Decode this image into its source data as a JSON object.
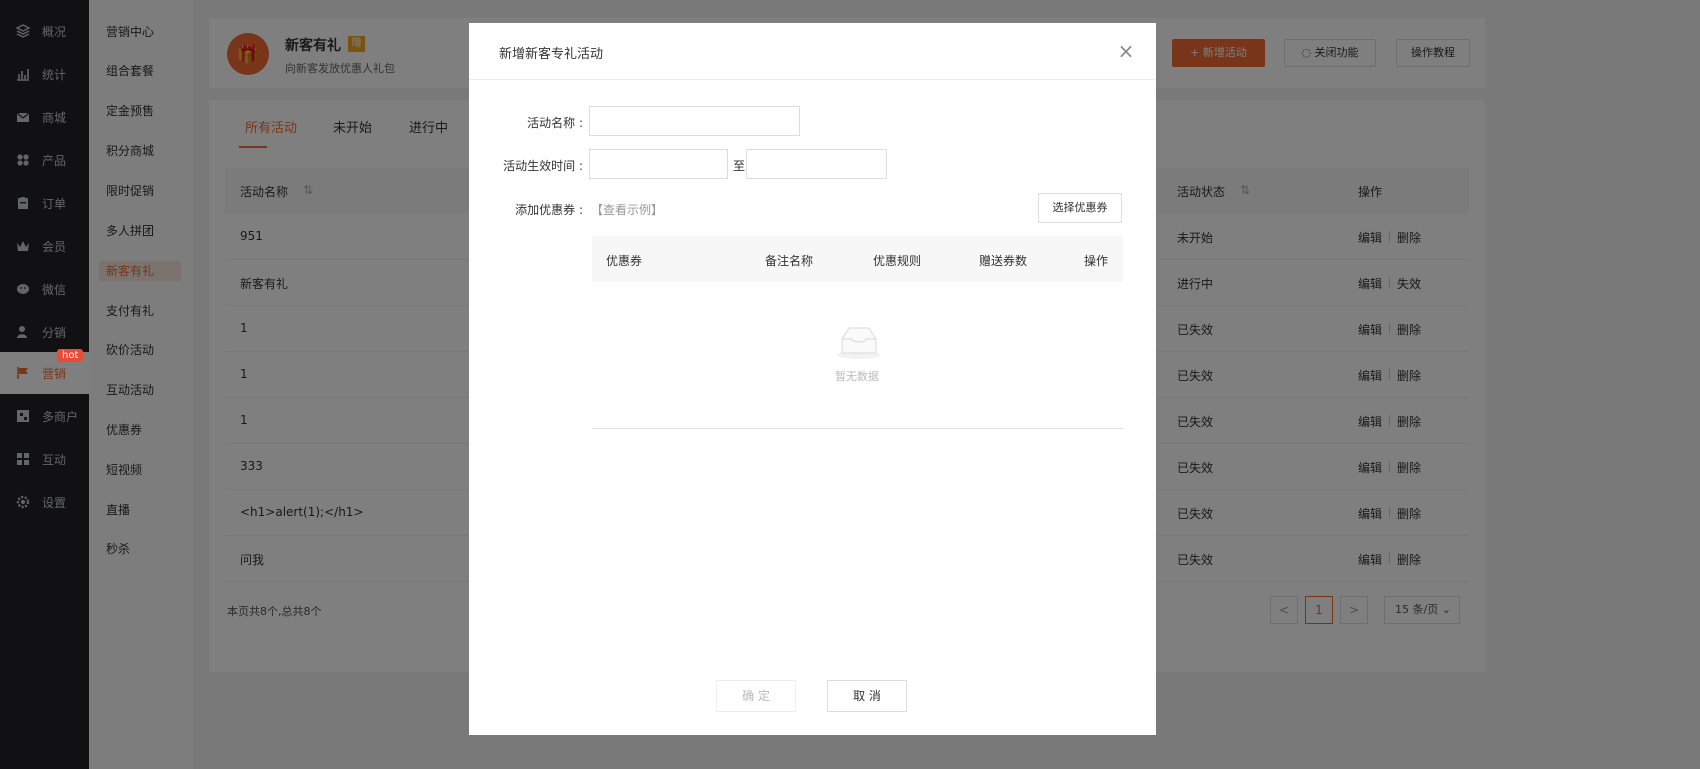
{
  "nav": {
    "items": [
      {
        "label": "概况",
        "icon": "layers-icon"
      },
      {
        "label": "统计",
        "icon": "chart-icon"
      },
      {
        "label": "商城",
        "icon": "mail-icon"
      },
      {
        "label": "产品",
        "icon": "grid-icon"
      },
      {
        "label": "订单",
        "icon": "clipboard-icon"
      },
      {
        "label": "会员",
        "icon": "crown-icon"
      },
      {
        "label": "微信",
        "icon": "wechat-icon"
      },
      {
        "label": "分销",
        "icon": "user-icon"
      },
      {
        "label": "营销",
        "icon": "flag-icon"
      },
      {
        "label": "多商户",
        "icon": "store-icon"
      },
      {
        "label": "互动",
        "icon": "apps-icon"
      },
      {
        "label": "设置",
        "icon": "gear-icon"
      }
    ],
    "hot_badge": "hot"
  },
  "subnav": {
    "items": [
      "营销中心",
      "组合套餐",
      "定金预售",
      "积分商城",
      "限时促销",
      "多人拼团",
      "新客有礼",
      "支付有礼",
      "砍价活动",
      "互动活动",
      "优惠券",
      "短视频",
      "直播",
      "秒杀"
    ]
  },
  "header": {
    "title": "新客有礼",
    "badge": "赠",
    "desc": "向新客发放优惠人礼包",
    "new_btn": "新增活动",
    "close_btn": "关闭功能",
    "tutorial_btn": "操作教程"
  },
  "tabs": [
    "所有活动",
    "未开始",
    "进行中"
  ],
  "table": {
    "col_name": "活动名称",
    "col_status": "活动状态",
    "col_ops": "操作",
    "rows": [
      {
        "name": "951",
        "status": "未开始",
        "op1": "编辑",
        "op2": "删除"
      },
      {
        "name": "新客有礼",
        "status": "进行中",
        "op1": "编辑",
        "op2": "失效"
      },
      {
        "name": "1",
        "status": "已失效",
        "op1": "编辑",
        "op2": "删除"
      },
      {
        "name": "1",
        "status": "已失效",
        "op1": "编辑",
        "op2": "删除"
      },
      {
        "name": "1",
        "status": "已失效",
        "op1": "编辑",
        "op2": "删除"
      },
      {
        "name": "333",
        "status": "已失效",
        "op1": "编辑",
        "op2": "删除"
      },
      {
        "name": "<h1>alert(1);</h1>",
        "status": "已失效",
        "op1": "编辑",
        "op2": "删除"
      },
      {
        "name": "问我",
        "status": "已失效",
        "op1": "编辑",
        "op2": "删除"
      }
    ]
  },
  "pager": {
    "summary": "本页共8个,总共8个",
    "prev": "<",
    "current": "1",
    "next": ">",
    "size": "15 条/页"
  },
  "modal": {
    "title": "新增新客专礼活动",
    "close": "×",
    "name_label": "活动名称 :",
    "name_value": "",
    "time_label": "活动生效时间 :",
    "time_start": "",
    "time_to": "至",
    "time_end": "",
    "coupon_label": "添加优惠券 :",
    "example_link": "【查看示例】",
    "choose_btn": "选择优惠券",
    "coupon_table": {
      "headers": [
        "优惠券",
        "备注名称",
        "优惠规则",
        "赠送券数",
        "操作"
      ],
      "empty": "暂无数据"
    },
    "ok": "确 定",
    "cancel": "取 消"
  }
}
